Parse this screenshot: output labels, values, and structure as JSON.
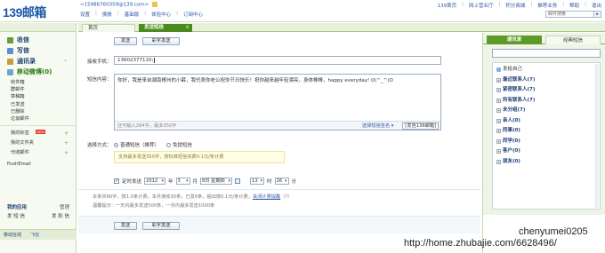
{
  "header": {
    "logo": "139邮箱",
    "account": "<15986760359@139.com>",
    "nav": [
      "设置",
      "换肤",
      "基础版",
      "体验中心",
      "订阅中心"
    ],
    "links": [
      "139首页",
      "网上营业厅",
      "积分商城",
      "推荐业务",
      "帮助",
      "退出"
    ],
    "search_placeholder": "邮件搜索",
    "search_go": "▸"
  },
  "tabs": {
    "home": "首页",
    "sms": "发送短信",
    "close": "×"
  },
  "sidebar": {
    "main": [
      {
        "label": "收信",
        "icon": "inbox-icon"
      },
      {
        "label": "写信",
        "icon": "write-icon"
      },
      {
        "label": "通讯录",
        "icon": "contacts-icon",
        "extra": "•"
      },
      {
        "label": "移动微博(0)",
        "icon": "weibo-icon"
      }
    ],
    "folders": [
      "收件箱",
      "群邮件",
      "草稿箱",
      "已发送",
      "已删除",
      "垃圾邮件"
    ],
    "groups": [
      {
        "label": "我的标签",
        "new": "NEW",
        "plus": "+"
      },
      {
        "label": "我的文件夹",
        "plus": "+"
      },
      {
        "label": "代收邮件",
        "plus": "+"
      }
    ],
    "push": "PushEmail",
    "apps_title": "我的应用",
    "apps_manage": "管理",
    "apps_row": [
      "发 短 信",
      "发 彩 信"
    ],
    "bottom": "移动在线",
    "bottom_fly": "飞信"
  },
  "main": {
    "send_label": "发送",
    "mms_label": "彩字发送",
    "to_label": "接收手机：",
    "to_value": "13602377110;",
    "content_label": "短信内容：",
    "content_text": "你好，我是来自湖南郴州的小薛，我代表你老公祝你节日快乐！祝你越来越年轻漂亮，身体棒棒，happy  everyday! O(^_^)O",
    "counter": "还可输入284字，最多350字",
    "signature_link": "选择短信签名 ▾",
    "from_label": "[发自139邮箱]",
    "mode_label": "选择方式：",
    "mode_normal": "普通短信（推荐）",
    "mode_free": "免提短信",
    "mode_hint": "支持最多发送350字，按标准短信资费0.1元/条计费",
    "timed_label": "定时发送",
    "year": "2012",
    "year_unit": "年",
    "month": "3",
    "month_unit": "月",
    "day": "8日 星期四",
    "hour": "13",
    "hour_unit": "时",
    "minute": "26",
    "minute_unit": "分",
    "info_line1_pre": "本条共66字，按1.0条计费，本月接收30条，已发6条，超出按0.1元/条计费，",
    "info_line1_link": "关闭计费提醒",
    "info_line1_post": "（?）",
    "info_line2": "温馨提示：一天内最多发送500条，一月内最多发送1000条"
  },
  "right_panel": {
    "tab_contacts": "通讯录",
    "tab_classic": "经典短信",
    "list": [
      {
        "label": "发给自己",
        "type": "self"
      },
      {
        "label": "最近联系人(7)",
        "type": "group"
      },
      {
        "label": "紧密联系人(7)",
        "type": "group"
      },
      {
        "label": "所有联系人(7)",
        "type": "group"
      },
      {
        "label": "未分组(7)",
        "type": "group"
      },
      {
        "label": "亲人(0)",
        "type": "group"
      },
      {
        "label": "同事(0)",
        "type": "group"
      },
      {
        "label": "同学(0)",
        "type": "group"
      },
      {
        "label": "客户(0)",
        "type": "group"
      },
      {
        "label": "朋友(0)",
        "type": "group"
      }
    ]
  },
  "watermark": {
    "line1": "chenyumei0205",
    "line2": "http://home.zhubajie.com/6628496/"
  },
  "colors": {
    "brand_green": "#4b8a1c",
    "link_blue": "#2c56a6",
    "sidebar_bg": "#f6faf0"
  }
}
